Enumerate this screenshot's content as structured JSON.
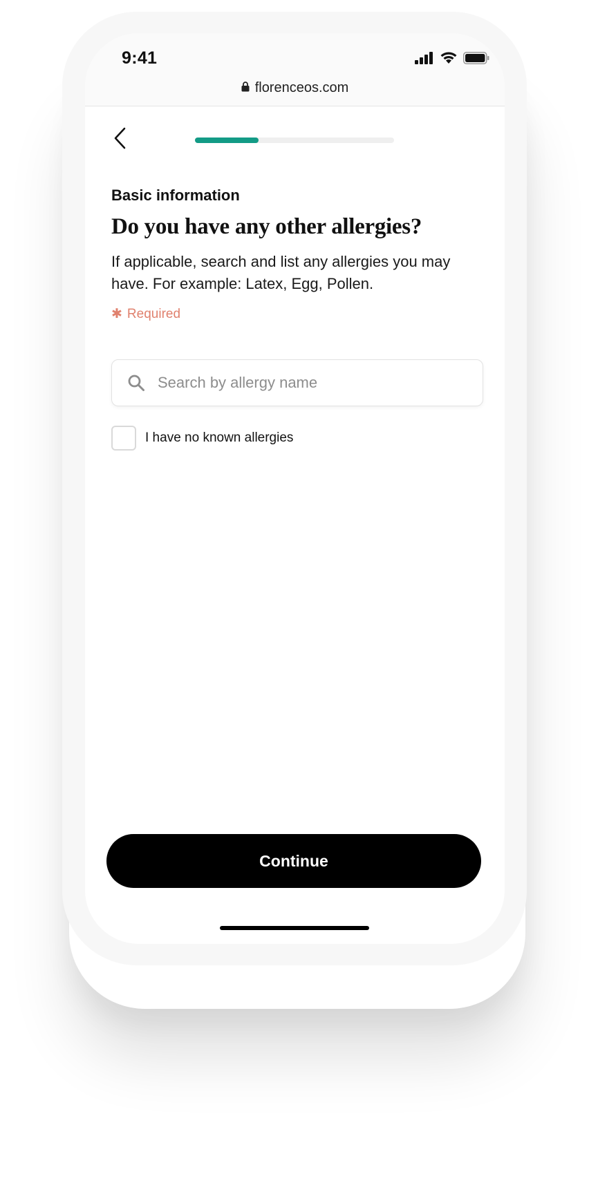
{
  "status_bar": {
    "time": "9:41",
    "icons": [
      "signal-icon",
      "wifi-icon",
      "battery-icon"
    ]
  },
  "browser": {
    "url": "florenceos.com",
    "lock_icon": "lock-icon"
  },
  "nav": {
    "back_icon": "chevron-left-icon",
    "progress": 0.32
  },
  "form": {
    "section_label": "Basic information",
    "question": "Do you have any other allergies?",
    "description": "If applicable, search and list any allergies you may have. For example: Latex, Egg, Pollen.",
    "required_marker": "✱",
    "required_label": "Required"
  },
  "search": {
    "placeholder": "Search by allergy name",
    "value": ""
  },
  "no_allergies": {
    "label": "I have no known allergies",
    "checked": false
  },
  "actions": {
    "continue_label": "Continue"
  },
  "colors": {
    "accent": "#139b86",
    "required": "#e0816e",
    "button": "#000000"
  }
}
